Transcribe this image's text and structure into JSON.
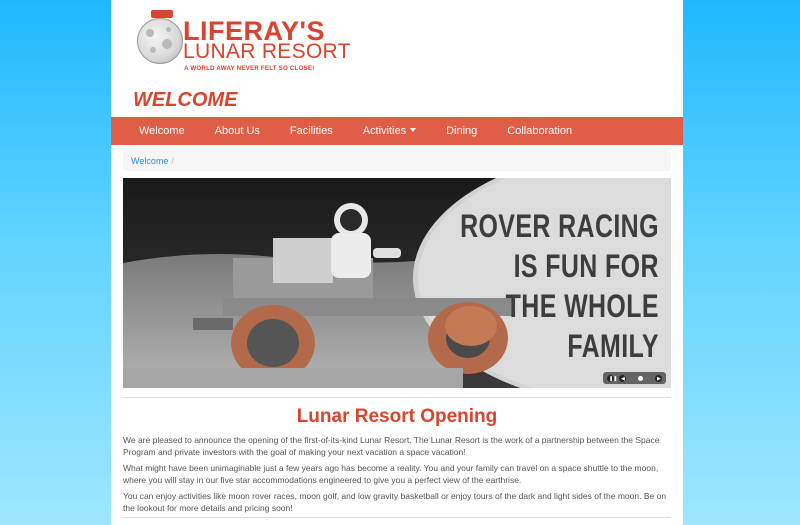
{
  "logo": {
    "title": "LIFERAY'S",
    "subtitle": "LUNAR RESORT",
    "tagline": "A WORLD AWAY NEVER FELT SO CLOSE!"
  },
  "page_title": "WELCOME",
  "nav": {
    "items": [
      {
        "label": "Welcome"
      },
      {
        "label": "About Us"
      },
      {
        "label": "Facilities"
      },
      {
        "label": "Activities"
      },
      {
        "label": "Dining"
      },
      {
        "label": "Collaboration"
      }
    ]
  },
  "breadcrumb": {
    "current": "Welcome",
    "separator": "/"
  },
  "carousel": {
    "slide_lines": [
      "ROVER RACING",
      "IS FUN FOR",
      "THE WHOLE",
      "FAMILY"
    ],
    "dot_count": 3,
    "active_dot": 2
  },
  "article": {
    "title": "Lunar Resort Opening",
    "paragraphs": [
      "We are pleased to announce the opening of the first-of-its-kind Lunar Resort. The Lunar Resort is the work of a partnership between the Space Program and private investors with the goal of making your next vacation a space vacation!",
      "What might have been unimaginable just a few years ago has become a reality. You and your family can travel on a space shuttle to the moon, where you will stay in our five star accommodations engineered to give you a perfect view of the earthrise.",
      "You can enjoy activities like moon rover races, moon golf, and low gravity basketball or enjoy tours of the dark and light sides of the moon. Be on the lookout for more details and pricing soon!"
    ]
  },
  "colors": {
    "brand_red": "#d9432f",
    "nav_bg": "#e05d48",
    "link_blue": "#2a8fd6",
    "sky_blue": "#1fb8ff"
  }
}
